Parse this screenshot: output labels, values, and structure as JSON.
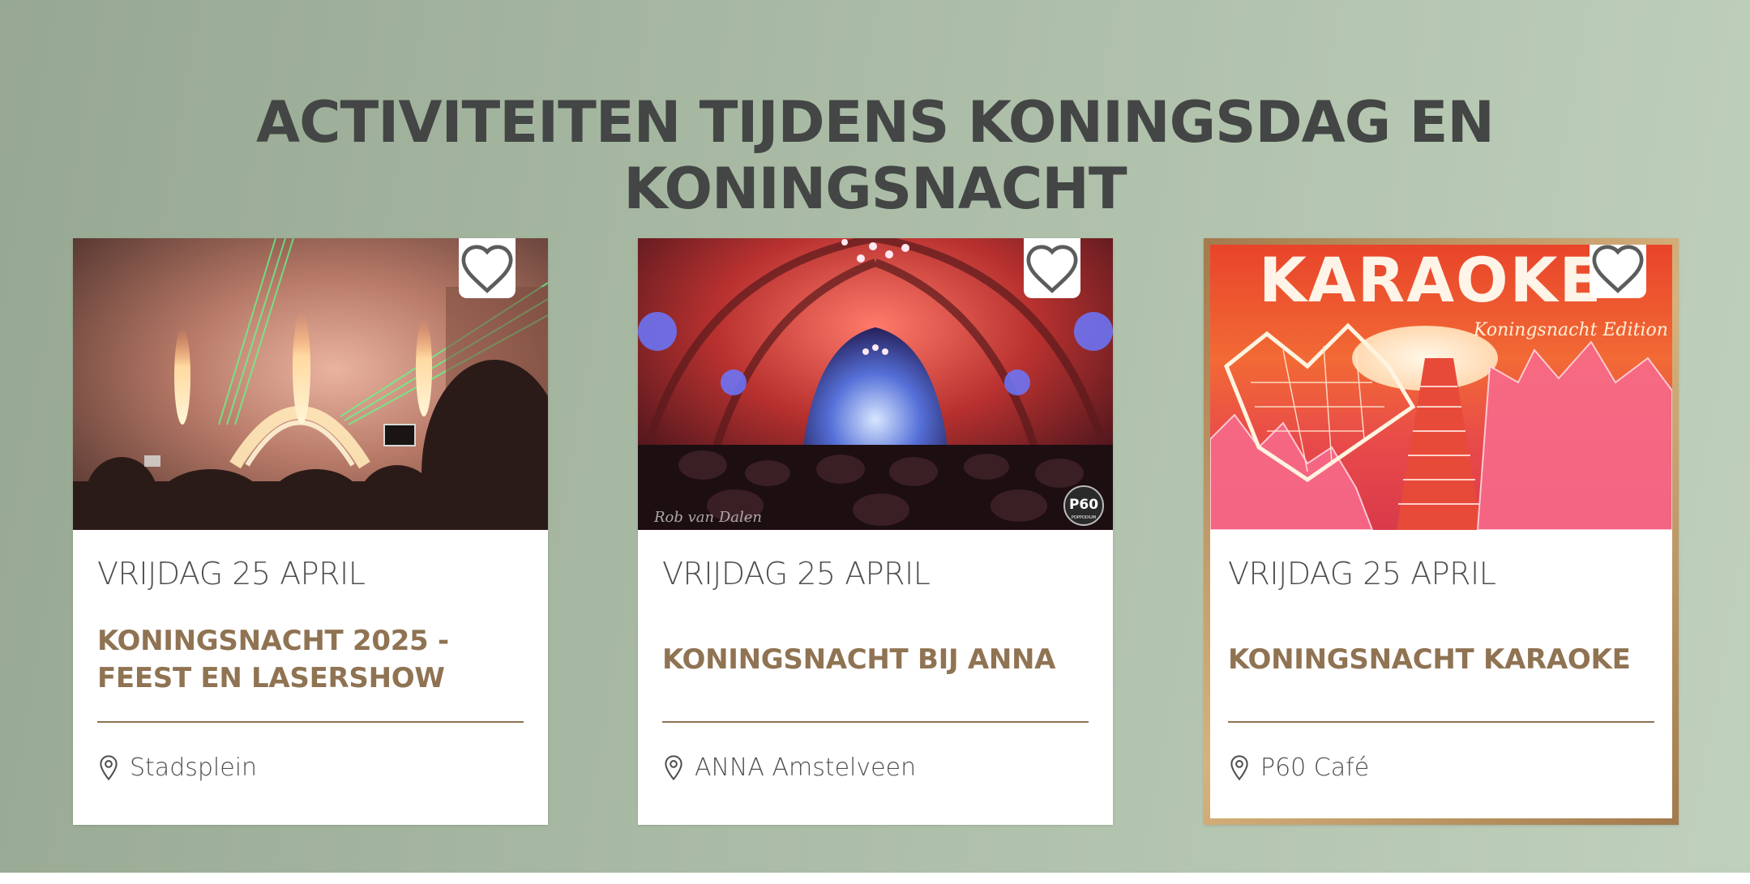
{
  "page": {
    "title": "ACTIVITEITEN TIJDENS KONINGSDAG EN KONINGSNACHT"
  },
  "events": [
    {
      "date": "VRIJDAG 25 APRIL",
      "title": "KONINGSNACHT 2025 - FEEST EN LASERSHOW",
      "location": "Stadsplein",
      "image": "laser show crowd photo",
      "favorite_icon": "heart-outline-icon"
    },
    {
      "date": "VRIJDAG 25 APRIL",
      "title": "KONINGSNACHT BIJ ANNA",
      "location": "ANNA Amstelveen",
      "image": "church venue concert photo",
      "image_text": [
        "Rob van Dalen",
        "P60",
        "POPPODIUM"
      ],
      "favorite_icon": "heart-outline-icon"
    },
    {
      "date": "VRIJDAG 25 APRIL",
      "title": "KONINGSNACHT KARAOKE",
      "location": "P60 Café",
      "image": "karaoke poster with neon crown",
      "image_text": [
        "KARAOKE",
        "Koningsnacht Edition"
      ],
      "favorite_icon": "heart-outline-icon"
    }
  ],
  "colors": {
    "title": "#434645",
    "event_title": "#8f7352",
    "card_border_highlight": "#c59e6c"
  }
}
